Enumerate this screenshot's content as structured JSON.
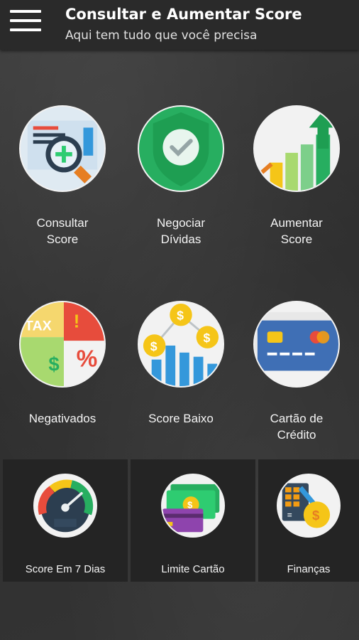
{
  "appbar": {
    "title": "Consultar e Aumentar Score",
    "subtitle": "Aqui tem tudo que você precisa",
    "menu_icon": "hamburger-menu-icon"
  },
  "grid": [
    {
      "label": "Consultar\nScore",
      "icon": "magnifier-plus-icon"
    },
    {
      "label": "Negociar\nDívidas",
      "icon": "shield-check-icon"
    },
    {
      "label": "Aumentar\nScore",
      "icon": "growth-bars-icon"
    },
    {
      "label": "Negativados",
      "icon": "tax-percent-icon"
    },
    {
      "label": "Score Baixo",
      "icon": "coins-chart-icon"
    },
    {
      "label": "Cartão de\nCrédito",
      "icon": "credit-card-icon"
    }
  ],
  "cards": [
    {
      "label": "Score Em 7 Dias",
      "icon": "speedometer-icon"
    },
    {
      "label": "Limite Cartão",
      "icon": "cash-card-icon"
    },
    {
      "label": "Finanças",
      "icon": "calculator-coin-icon"
    }
  ],
  "colors": {
    "appbar": "#2a2a2a",
    "card": "#242424",
    "green": "#27ae60",
    "yellow": "#f5c518"
  }
}
